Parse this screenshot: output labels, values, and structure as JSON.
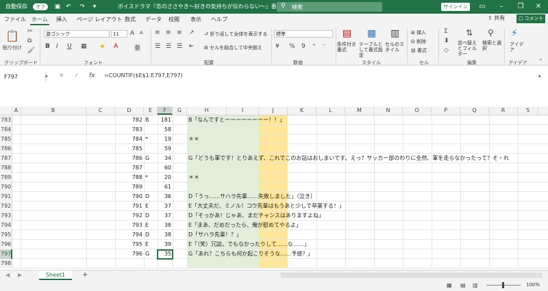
{
  "titlebar": {
    "autosave": "自動保存",
    "autosave_state": "オフ",
    "title": "ボイスドラマ『恋のささやき〜好きの気持ちが伝わらない〜』番号",
    "search_placeholder": "検索",
    "signin": "サインイン"
  },
  "tabs": [
    "ファイル",
    "ホーム",
    "挿入",
    "ページ レイアウト",
    "数式",
    "データ",
    "校閲",
    "表示",
    "ヘルプ"
  ],
  "share": "共有",
  "comment": "コメント",
  "ribbon": {
    "paste": "貼り付け",
    "clipboard": "クリップボード",
    "font_name": "游ゴシック",
    "font_size": "11",
    "font_group": "フォント",
    "wrap": "折り返して全体を表示する",
    "merge": "セルを結合して中央揃え",
    "align_group": "配置",
    "number_format": "標準",
    "number_group": "数値",
    "cond_format": "条件付き書式",
    "table_format": "テーブルとして書式設定",
    "cell_style": "セルのスタイル",
    "style_group": "スタイル",
    "insert": "挿入",
    "delete": "削除",
    "format": "書式",
    "cell_group": "セル",
    "sort": "並べ替えとフィルター",
    "find": "検索と選択",
    "edit_group": "編集",
    "ideas": "アイデア",
    "ideas_group": "アイデア"
  },
  "formula_bar": {
    "name_box": "F797",
    "formula": "=COUNTIF($E$1:E797,E797)"
  },
  "columns": [
    "A",
    "B",
    "C",
    "D",
    "E",
    "F",
    "G",
    "H",
    "I",
    "J",
    "K",
    "L",
    "M",
    "N",
    "O",
    "P",
    "Q",
    "R",
    "S"
  ],
  "selected_column": "F",
  "rows": [
    {
      "n": "783",
      "d": "782",
      "e": "B",
      "f": "181",
      "h": "B「なんですとーーーーーーーー！！」"
    },
    {
      "n": "784",
      "d": "783",
      "e": "",
      "f": "58",
      "h": ""
    },
    {
      "n": "785",
      "d": "784",
      "e": "*",
      "f": "19",
      "h": "＊＊"
    },
    {
      "n": "786",
      "d": "785",
      "e": "",
      "f": "59",
      "h": ""
    },
    {
      "n": "787",
      "d": "786",
      "e": "G",
      "f": "34",
      "h": "G「どうも軍です！とりあえず、これでこのお話はおしまいです。えっ？サッカー部のわりに全然、軍を走らなかったって？そ・れ"
    },
    {
      "n": "788",
      "d": "787",
      "e": "",
      "f": "60",
      "h": ""
    },
    {
      "n": "789",
      "d": "788",
      "e": "*",
      "f": "20",
      "h": "＊＊"
    },
    {
      "n": "790",
      "d": "789",
      "e": "",
      "f": "61",
      "h": ""
    },
    {
      "n": "791",
      "d": "790",
      "e": "D",
      "f": "36",
      "h": "D「うっ……サハラ先輩……失敗しました」（泣き）"
    },
    {
      "n": "792",
      "d": "791",
      "e": "E",
      "f": "37",
      "h": "E「大丈夫だ、ミノル！コウ先輩はもうあと少しで卒業する！」"
    },
    {
      "n": "793",
      "d": "792",
      "e": "D",
      "f": "37",
      "h": "D「そっかあ！じゃあ、まだチャンスはありますよね」"
    },
    {
      "n": "794",
      "d": "793",
      "e": "E",
      "f": "38",
      "h": "E「まあ、だめだったら、俺が慰めてやるよ」"
    },
    {
      "n": "795",
      "d": "794",
      "e": "D",
      "f": "38",
      "h": "D「サハラ先輩！？」"
    },
    {
      "n": "796",
      "d": "795",
      "e": "E",
      "f": "39",
      "h": "E「（笑）冗談。でもなかったりして……な……」"
    },
    {
      "n": "797",
      "d": "796",
      "e": "G",
      "f": "35",
      "h": "G「あれ？こちらも何か起こりそうな……予感？」"
    },
    {
      "n": "798",
      "d": "",
      "e": "",
      "f": "",
      "h": ""
    }
  ],
  "selected_row": "797",
  "sheet": {
    "name": "Sheet1",
    "add": "+"
  },
  "status": {
    "zoom": "100%"
  }
}
